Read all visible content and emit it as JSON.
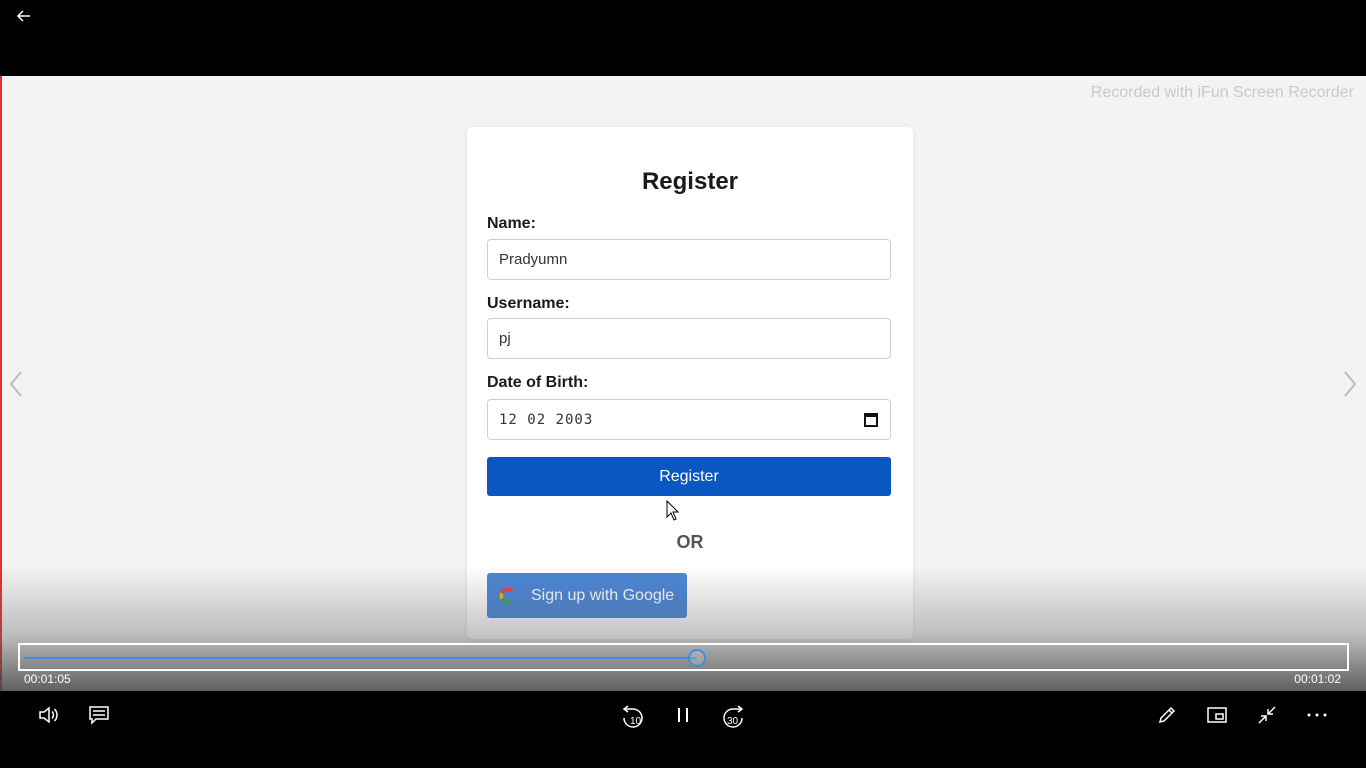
{
  "topbar": {
    "back_icon": "back-arrow-icon"
  },
  "video": {
    "watermark": "Recorded with iFun Screen Recorder"
  },
  "form": {
    "title": "Register",
    "name_label": "Name:",
    "name_value": "Pradyumn",
    "username_label": "Username:",
    "username_value": "pj",
    "dob_label": "Date of Birth:",
    "dob_value": "12 02 2003",
    "register_label": "Register",
    "or_text": "OR",
    "google_label": "Sign up with Google"
  },
  "player": {
    "progress": 0.51,
    "time_elapsed": "00:01:05",
    "time_remaining": "00:01:02",
    "accent_color": "#3b8ee0",
    "controls": {
      "volume_icon": "volume-icon",
      "captions_icon": "captions-icon",
      "rewind_label": "10",
      "forward_label": "30",
      "pause_icon": "pause-icon",
      "edit_icon": "pencil-icon",
      "miniview_icon": "mini-view-icon",
      "exit_fullscreen_icon": "exit-fullscreen-icon",
      "more_icon": "more-icon"
    }
  }
}
